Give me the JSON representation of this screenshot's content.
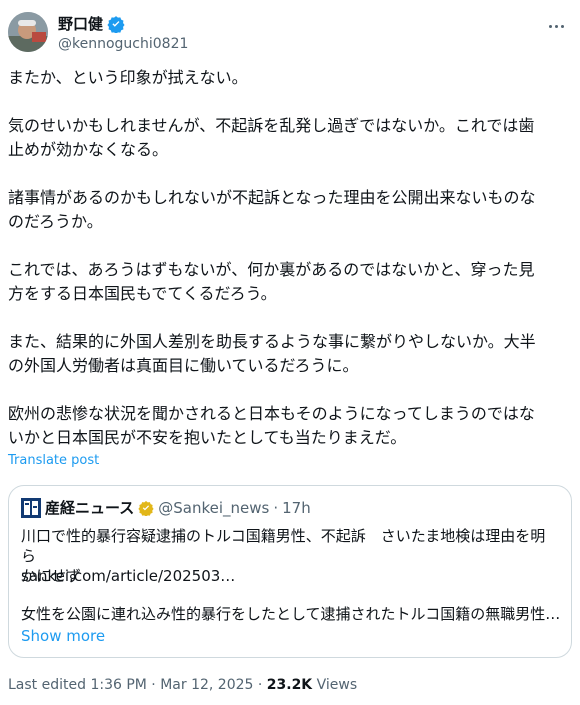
{
  "author": {
    "name": "野口健",
    "handle": "@kennoguchi0821",
    "verified_color": "#1d9bf0"
  },
  "body": {
    "paragraphs": [
      "またか、という印象が拭えない。",
      "気のせいかもしれませんが、不起訴を乱発し過ぎではないか。これでは歯\n止めが効かなくなる。",
      "諸事情があるのかもしれないが不起訴となった理由を公開出来ないものな\nのだろうか。",
      "これでは、あろうはずもないが、何か裏があるのではないかと、穿った見\n方をする日本国民もでてくるだろう。",
      "また、結果的に外国人差別を助長するような事に繋がりやしないか。大半\nの外国人労働者は真面目に働いているだろうに。",
      "欧州の悲惨な状況を聞かされると日本もそのようになってしまうのではな\nいかと日本国民が不安を抱いたとしても当たりまえだ。"
    ]
  },
  "translate_label": "Translate post",
  "quote": {
    "name": "産経ニュース",
    "verified_color": "#e2b719",
    "handle": "@Sankei_news",
    "separator": "·",
    "time": "17h",
    "text": "川口で性的暴行容疑逮捕のトルコ国籍男性、不起訴　さいたま地検は理由を明ら\nかにせず",
    "link": "sankei.com/article/202503…",
    "snippet": "女性を公園に連れ込み性的暴行をしたとして逮捕されたトルコ国籍の無職男性…",
    "show_more": "Show more"
  },
  "footer": {
    "edited": "Last edited 1:36 PM · Mar 12, 2025 · ",
    "views_count": "23.2K",
    "views_label": " Views"
  }
}
